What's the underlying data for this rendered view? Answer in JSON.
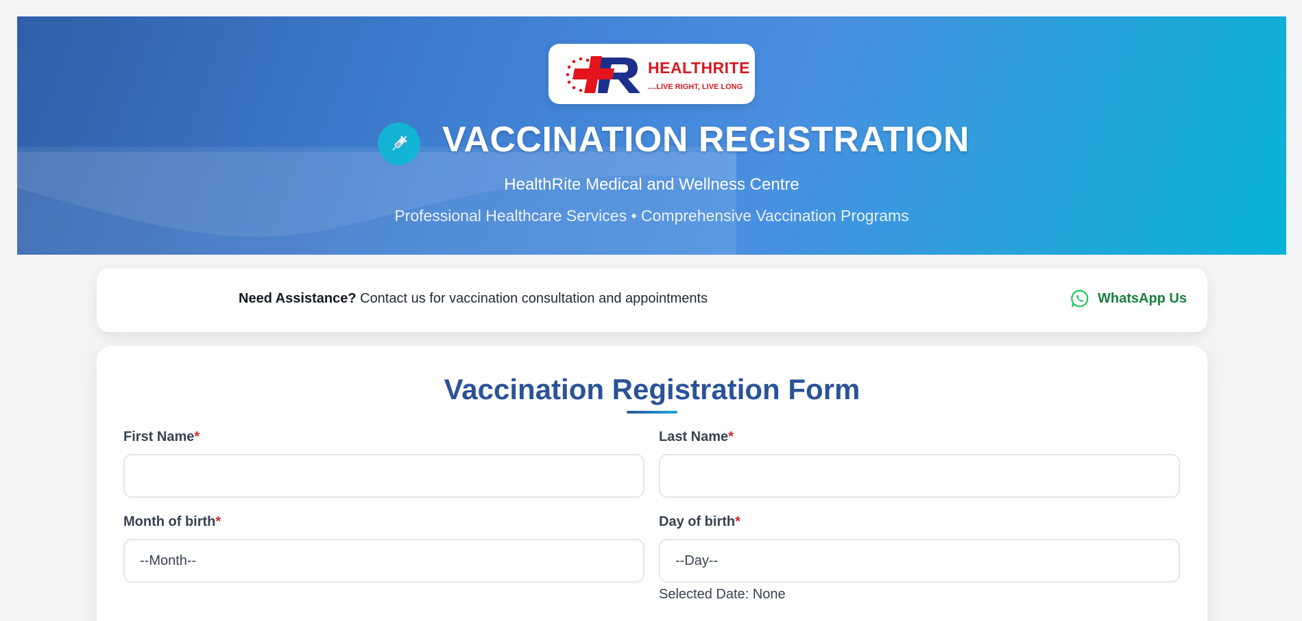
{
  "header": {
    "logo": {
      "brand": "HEALTHRITE",
      "tagline": "....LIVE RIGHT, LIVE LONG",
      "mark_letters": "+R"
    },
    "icon": "syringe-icon",
    "title": "VACCINATION REGISTRATION",
    "subtitle": "HealthRite Medical and Wellness Centre",
    "tagline": "Professional Healthcare Services • Comprehensive Vaccination Programs"
  },
  "assist": {
    "lead": "Need Assistance?",
    "text": " Contact us for vaccination consultation and appointments",
    "whatsapp_label": "WhatsApp Us",
    "whatsapp_icon": "whatsapp-icon"
  },
  "form": {
    "title": "Vaccination Registration Form",
    "required_marker": "*",
    "first_name": {
      "label": "First Name",
      "value": ""
    },
    "last_name": {
      "label": "Last Name",
      "value": ""
    },
    "month": {
      "label": "Month of birth",
      "selected": "--Month--"
    },
    "day": {
      "label": "Day of birth",
      "selected": "--Day--"
    },
    "selected_date": "Selected Date: None"
  },
  "colors": {
    "primary": "#2a5298",
    "accent": "#1fa7d9",
    "required": "#dc2626",
    "whatsapp": "#15803d",
    "brand_red": "#d71920"
  }
}
